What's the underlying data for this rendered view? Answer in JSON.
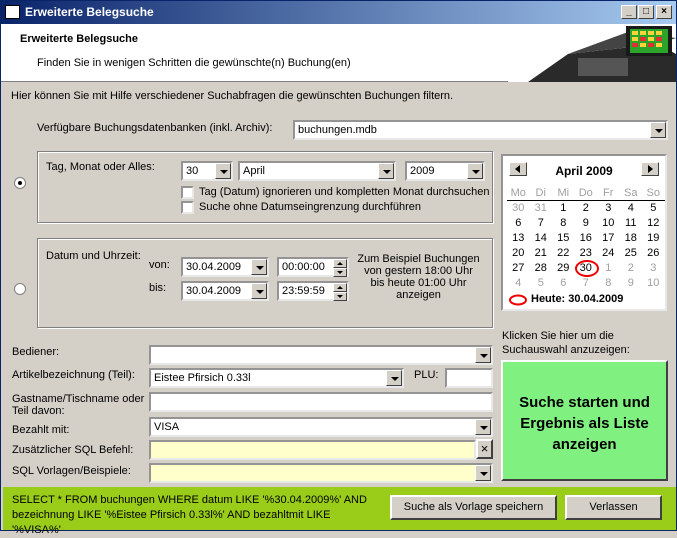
{
  "window": {
    "title": "Erweiterte Belegsuche"
  },
  "header": {
    "title": "Erweiterte Belegsuche",
    "subtitle": "Finden Sie in wenigen Schritten die gewünschte(n) Buchung(en)"
  },
  "intro": "Hier können Sie mit Hilfe verschiedener Suchabfragen die gewünschten Buchungen filtern.",
  "database": {
    "label": "Verfügbare Buchungsdatenbanken (inkl. Archiv):",
    "value": "buchungen.mdb"
  },
  "day_group": {
    "label": "Tag, Monat oder Alles:",
    "day": "30",
    "month": "April",
    "year": "2009",
    "chk_ignore_day": "Tag (Datum) ignorieren und kompletten Monat durchsuchen",
    "chk_no_date": "Suche ohne Datumseingrenzung durchführen"
  },
  "datetime_group": {
    "label": "Datum und Uhrzeit:",
    "from_label": "von:",
    "to_label": "bis:",
    "from_date": "30.04.2009",
    "from_time": "00:00:00",
    "to_date": "30.04.2009",
    "to_time": "23:59:59",
    "hint": "Zum Beispiel Buchungen von gestern 18:00 Uhr bis heute 01:00 Uhr anzeigen"
  },
  "calendar": {
    "title": "April 2009",
    "weekdays": [
      "Mo",
      "Di",
      "Mi",
      "Do",
      "Fr",
      "Sa",
      "So"
    ],
    "weeks": [
      [
        "30",
        "31",
        "1",
        "2",
        "3",
        "4",
        "5"
      ],
      [
        "6",
        "7",
        "8",
        "9",
        "10",
        "11",
        "12"
      ],
      [
        "13",
        "14",
        "15",
        "16",
        "17",
        "18",
        "19"
      ],
      [
        "20",
        "21",
        "22",
        "23",
        "24",
        "25",
        "26"
      ],
      [
        "27",
        "28",
        "29",
        "30",
        "1",
        "2",
        "3"
      ],
      [
        "4",
        "5",
        "6",
        "7",
        "8",
        "9",
        "10"
      ]
    ],
    "today_label": "Heute:",
    "today_value": "30.04.2009"
  },
  "fields": {
    "operator_label": "Bediener:",
    "operator_value": "",
    "article_label": "Artikelbezeichnung (Teil):",
    "article_value": "Eistee Pfirsich 0.33l",
    "plu_label": "PLU:",
    "plu_value": "",
    "guest_label": "Gastname/Tischname oder Teil davon:",
    "guest_value": "",
    "paid_label": "Bezahlt mit:",
    "paid_value": "VISA",
    "sql_label": "Zusätzlicher SQL Befehl:",
    "sql_value": "",
    "templates_label": "SQL Vorlagen/Beispiele:",
    "templates_value": ""
  },
  "search": {
    "hint": "Klicken Sie hier um die Suchauswahl anzuzeigen:",
    "button": "Suche starten und Ergebnis als Liste anzeigen"
  },
  "footer": {
    "sql": "SELECT * FROM buchungen WHERE datum LIKE '%30.04.2009%' AND bezeichnung LIKE '%Eistee Pfirsich 0.33l%' AND bezahltmit LIKE '%VISA%'",
    "save_button": "Suche als Vorlage speichern",
    "exit_button": "Verlassen"
  },
  "colors": {
    "title_gradient_start": "#0a246a",
    "search_button": "#80f080",
    "footer": "#9acd1a",
    "sql_fields": "#ffffcc"
  }
}
